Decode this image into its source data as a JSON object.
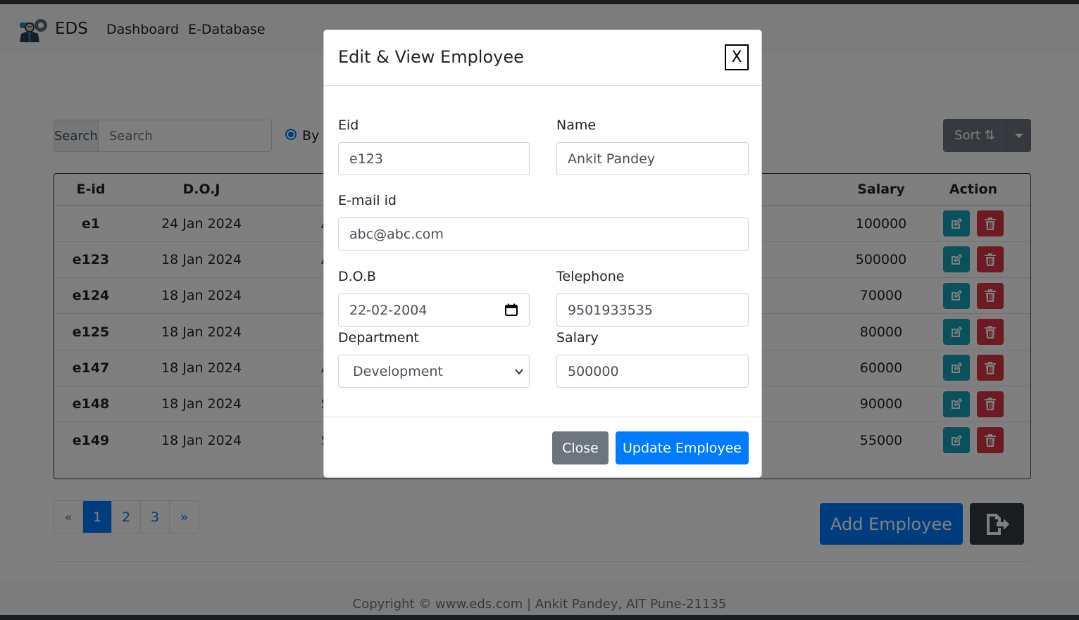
{
  "navbar": {
    "brand": "EDS",
    "links": [
      "Dashboard",
      "E-Database"
    ]
  },
  "search": {
    "addon_label": "Search",
    "placeholder": "Search",
    "radio_label": "By I"
  },
  "sort": {
    "label": "Sort ⇅"
  },
  "table": {
    "headers": [
      "E-id",
      "D.O.J",
      "Salary",
      "Action"
    ],
    "rows": [
      {
        "eid": "e1",
        "doj": "24 Jan 2024",
        "partial": "A",
        "salary": "100000"
      },
      {
        "eid": "e123",
        "doj": "18 Jan 2024",
        "partial": "A",
        "salary": "500000"
      },
      {
        "eid": "e124",
        "doj": "18 Jan 2024",
        "partial": "",
        "salary": "70000"
      },
      {
        "eid": "e125",
        "doj": "18 Jan 2024",
        "partial": "",
        "salary": "80000"
      },
      {
        "eid": "e147",
        "doj": "18 Jan 2024",
        "partial": "A",
        "salary": "60000"
      },
      {
        "eid": "e148",
        "doj": "18 Jan 2024",
        "partial": "S",
        "salary": "90000"
      },
      {
        "eid": "e149",
        "doj": "18 Jan 2024",
        "partial": "S",
        "salary": "55000"
      }
    ]
  },
  "pagination": [
    "«",
    "1",
    "2",
    "3",
    "»"
  ],
  "add_employee_label": "Add Employee",
  "footer_text": "Copyright © www.eds.com | Ankit Pandey, AIT Pune-21135",
  "modal": {
    "title": "Edit & View Employee",
    "close_x": "X",
    "fields": {
      "eid_label": "Eid",
      "eid_value": "e123",
      "name_label": "Name",
      "name_value": "Ankit Pandey",
      "email_label": "E-mail id",
      "email_value": "abc@abc.com",
      "dob_label": "D.O.B",
      "dob_value": "22-02-2004",
      "telephone_label": "Telephone",
      "telephone_value": "9501933535",
      "department_label": "Department",
      "department_value": "Development",
      "salary_label": "Salary",
      "salary_value": "500000"
    },
    "close_label": "Close",
    "update_label": "Update Employee"
  },
  "colors": {
    "primary": "#007bff",
    "secondary": "#6c757d",
    "info": "#17a2b8",
    "danger": "#dc3545",
    "dark": "#343a40"
  }
}
